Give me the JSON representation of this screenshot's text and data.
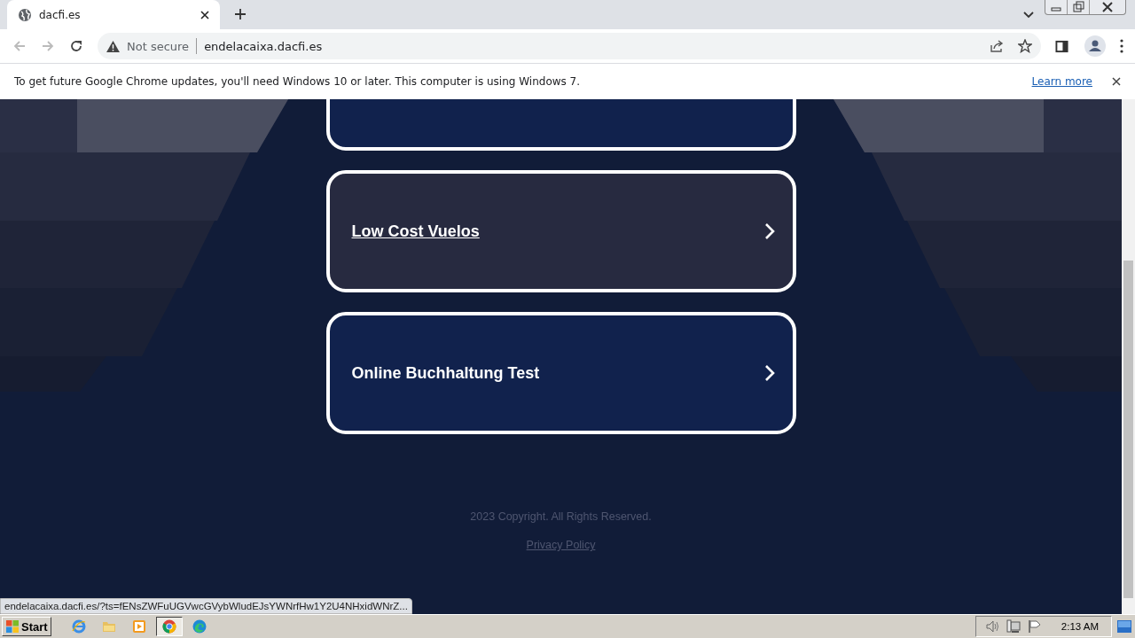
{
  "browser": {
    "tab": {
      "title": "dacfi.es"
    },
    "address": {
      "security": "Not secure",
      "url": "endelacaixa.dacfi.es"
    },
    "infobar": {
      "message": "To get future Google Chrome updates, you'll need Windows 10 or later. This computer is using Windows 7.",
      "link": "Learn more"
    }
  },
  "page": {
    "cards": [
      {
        "hovered": false
      },
      {
        "label": "Low Cost Vuelos",
        "hovered": true
      },
      {
        "label": "Online Buchhaltung Test",
        "hovered": false
      }
    ],
    "copyright": "2023 Copyright. All Rights Reserved.",
    "privacy_link": "Privacy Policy"
  },
  "status_url": "endelacaixa.dacfi.es/?ts=fENsZWFuUGVwcGVybWludEJsYWNrfHw1Y2U4NHxidWNrZ...",
  "taskbar": {
    "start": "Start",
    "apps": [
      {
        "kind": "ie",
        "selected": false
      },
      {
        "kind": "folder",
        "selected": false
      },
      {
        "kind": "media",
        "selected": false
      },
      {
        "kind": "chrome",
        "selected": true
      },
      {
        "kind": "edge",
        "selected": false
      }
    ],
    "clock": "2:13 AM"
  }
}
